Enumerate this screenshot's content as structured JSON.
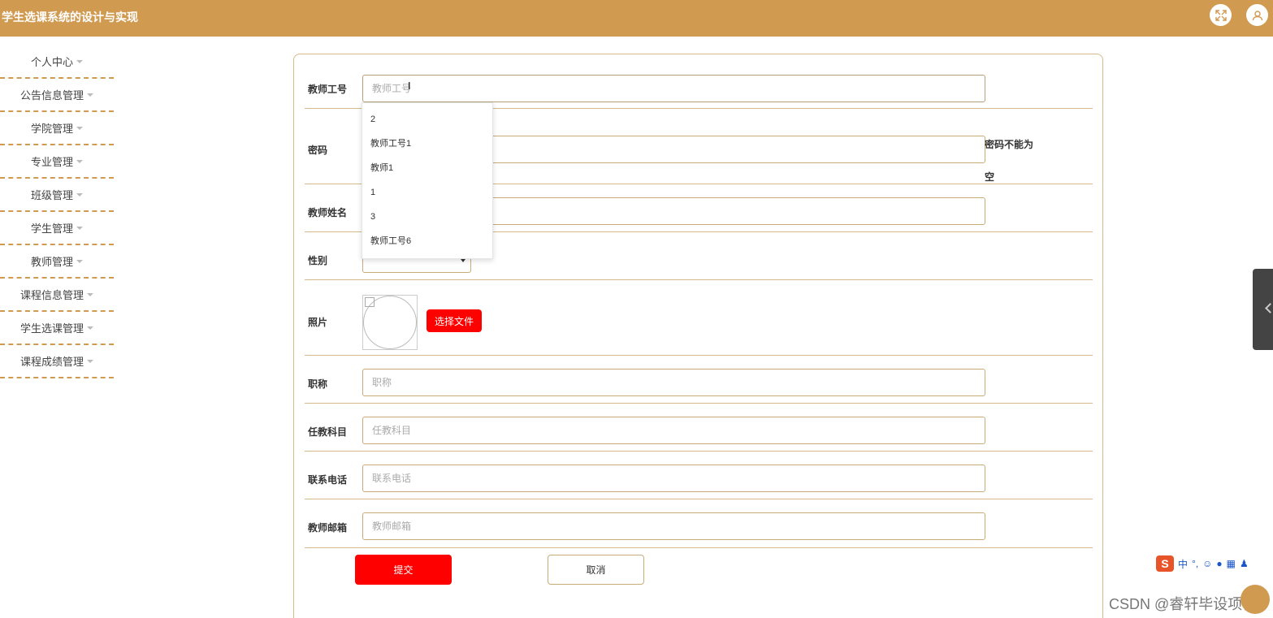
{
  "app": {
    "title": "学生选课系统的设计与实现",
    "accent_color": "#d09a50",
    "header_icons": [
      "fullscreen-icon",
      "user-icon"
    ]
  },
  "sidebar": {
    "items": [
      {
        "label": "个人中心"
      },
      {
        "label": "公告信息管理"
      },
      {
        "label": "学院管理"
      },
      {
        "label": "专业管理"
      },
      {
        "label": "班级管理"
      },
      {
        "label": "学生管理"
      },
      {
        "label": "教师管理"
      },
      {
        "label": "课程信息管理"
      },
      {
        "label": "学生选课管理"
      },
      {
        "label": "课程成绩管理"
      }
    ]
  },
  "form": {
    "teacher_id": {
      "label": "教师工号",
      "placeholder": "教师工号",
      "value": ""
    },
    "password": {
      "label": "密码",
      "value": "",
      "error": "密码不能为空"
    },
    "teacher_name": {
      "label": "教师姓名",
      "value": ""
    },
    "gender": {
      "label": "性别",
      "value": ""
    },
    "photo": {
      "label": "照片",
      "button": "选择文件"
    },
    "title": {
      "label": "职称",
      "placeholder": "职称",
      "value": ""
    },
    "subject": {
      "label": "任教科目",
      "placeholder": "任教科目",
      "value": ""
    },
    "phone": {
      "label": "联系电话",
      "placeholder": "联系电话",
      "value": ""
    },
    "email": {
      "label": "教师邮箱",
      "placeholder": "教师邮箱",
      "value": ""
    },
    "submit": "提交",
    "cancel": "取消"
  },
  "autocomplete": {
    "options": [
      "2",
      "教师工号1",
      "教师1",
      "1",
      "3",
      "教师工号6"
    ]
  },
  "ime_toolbar": {
    "logo": "S",
    "mode": "中",
    "punct": "°,"
  },
  "watermark": "CSDN @睿轩毕设项目",
  "colors": {
    "submit": "#ff0000",
    "file_button": "#ff0000",
    "border": "#c9ab78"
  }
}
